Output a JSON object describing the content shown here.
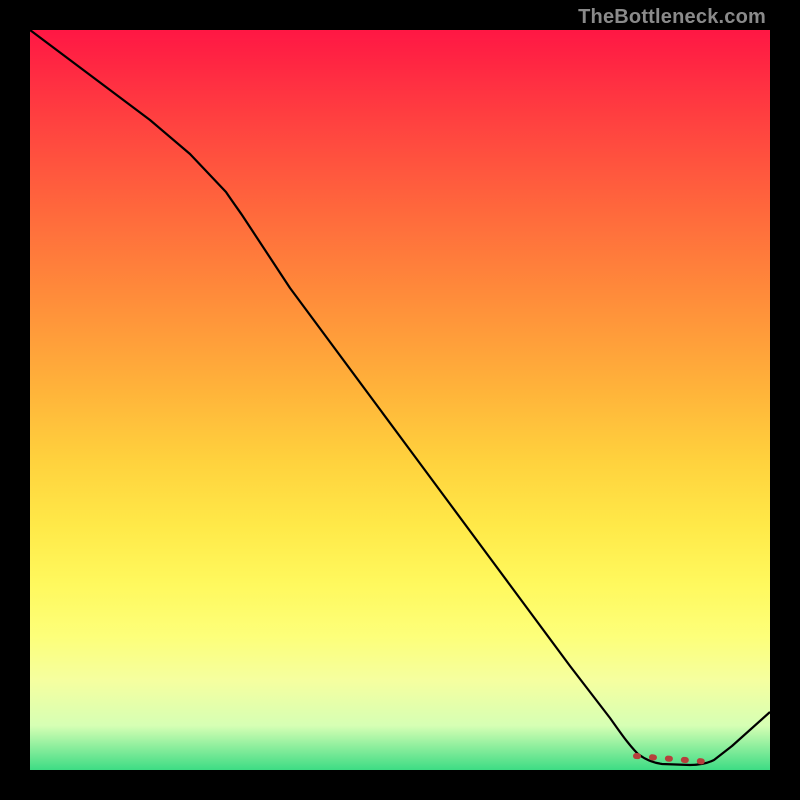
{
  "watermark": "TheBottleneck.com",
  "colors": {
    "background": "#000000",
    "curve": "#000000",
    "dots": "#b6403c",
    "gradient_top": "#ff1744",
    "gradient_bottom": "#3ddc84"
  },
  "chart_data": {
    "type": "line",
    "title": "",
    "xlabel": "",
    "ylabel": "",
    "xlim": [
      0,
      100
    ],
    "ylim": [
      0,
      100
    ],
    "grid": false,
    "legend": false,
    "x": [
      0,
      5,
      10,
      15,
      20,
      25,
      27,
      30,
      35,
      40,
      45,
      50,
      55,
      60,
      65,
      70,
      75,
      80,
      82,
      84,
      86,
      88,
      90,
      92,
      95,
      100
    ],
    "values": [
      100,
      96,
      92,
      88,
      83,
      78,
      76,
      72,
      65,
      58,
      51,
      44,
      37,
      30,
      23,
      16,
      9,
      3,
      1.5,
      0.8,
      0.5,
      0.5,
      0.5,
      1.0,
      3,
      8
    ],
    "highlight_range_x": [
      82,
      92
    ],
    "notes": "Curve descends from top-left, steepens after x≈27, reaches a flat minimum near x≈84–90, then rises slightly at right edge. Highlight dots mark the flat minimum segment."
  }
}
